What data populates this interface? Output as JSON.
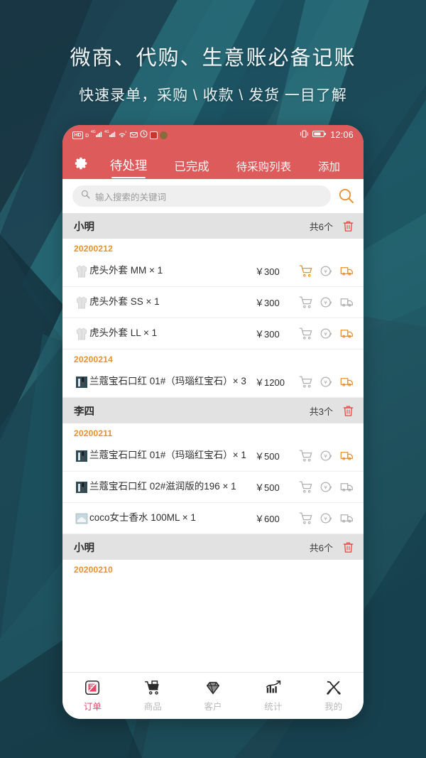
{
  "promo": {
    "title": "微商、代购、生意账必备记账",
    "subtitle": "快速录单，采购 \\ 收款 \\ 发货 一目了解"
  },
  "colors": {
    "header_red": "#dd5b5b",
    "accent_orange": "#e8912f",
    "date_orange": "#e8912f",
    "nav_active_pink": "#e8456b",
    "trash_red": "#e8453f",
    "icon_gray": "#b0b0b0",
    "bg_teal": "#21515c"
  },
  "statusbar": {
    "hd_label": "HD",
    "network_label_1": "4G",
    "network_label_2": "4G",
    "wifi_superscript": "1",
    "time": "12:06",
    "icons": [
      "hd-icon",
      "signal-icon",
      "signal-icon",
      "wifi-icon",
      "message-icon",
      "alarm-icon",
      "app-icon",
      "app-icon",
      "vibrate-icon",
      "battery-icon"
    ]
  },
  "header": {
    "settings_icon": "gear-icon",
    "tabs": [
      {
        "label": "待处理",
        "active": true
      },
      {
        "label": "已完成",
        "active": false
      },
      {
        "label": "待采购列表",
        "active": false
      },
      {
        "label": "添加",
        "active": false
      }
    ]
  },
  "search": {
    "placeholder": "输入搜索的关键词",
    "value": "",
    "left_icon": "search-icon",
    "right_icon": "search-icon"
  },
  "list": {
    "groups": [
      {
        "name": "小明",
        "count_label": "共6个",
        "delete_icon": "trash-icon",
        "dates": [
          {
            "date": "20200212",
            "items": [
              {
                "thumb": "jacket-thumb",
                "name": "虎头外套 MM × 1",
                "price": "￥300",
                "cart_active": true,
                "refund_active": false,
                "ship_active": true
              },
              {
                "thumb": "jacket-thumb",
                "name": "虎头外套 SS × 1",
                "price": "￥300",
                "cart_active": false,
                "refund_active": false,
                "ship_active": false
              },
              {
                "thumb": "jacket-thumb",
                "name": "虎头外套 LL × 1",
                "price": "￥300",
                "cart_active": false,
                "refund_active": false,
                "ship_active": true
              }
            ]
          },
          {
            "date": "20200214",
            "items": [
              {
                "thumb": "lipstick-thumb",
                "name": "兰蔻宝石口红 01#（玛瑙红宝石）× 3",
                "price": "￥1200",
                "cart_active": false,
                "refund_active": false,
                "ship_active": true
              }
            ]
          }
        ]
      },
      {
        "name": "李四",
        "count_label": "共3个",
        "delete_icon": "trash-icon",
        "dates": [
          {
            "date": "20200211",
            "items": [
              {
                "thumb": "lipstick-thumb",
                "name": "兰蔻宝石口红 01#（玛瑙红宝石）× 1",
                "price": "￥500",
                "cart_active": false,
                "refund_active": false,
                "ship_active": true
              },
              {
                "thumb": "lipstick-thumb",
                "name": "兰蔻宝石口红 02#滋润版的196 × 1",
                "price": "￥500",
                "cart_active": false,
                "refund_active": false,
                "ship_active": false
              },
              {
                "thumb": "perfume-thumb",
                "name": "coco女士香水 100ML × 1",
                "price": "￥600",
                "cart_active": false,
                "refund_active": false,
                "ship_active": false
              }
            ]
          }
        ]
      },
      {
        "name": "小明",
        "count_label": "共6个",
        "delete_icon": "trash-icon",
        "dates": [
          {
            "date": "20200210",
            "items": []
          }
        ]
      }
    ]
  },
  "bottomnav": {
    "items": [
      {
        "label": "订单",
        "icon": "order-icon",
        "active": true
      },
      {
        "label": "商品",
        "icon": "cart-icon",
        "active": false
      },
      {
        "label": "客户",
        "icon": "diamond-icon",
        "active": false
      },
      {
        "label": "统计",
        "icon": "chart-icon",
        "active": false
      },
      {
        "label": "我的",
        "icon": "tools-icon",
        "active": false
      }
    ]
  }
}
